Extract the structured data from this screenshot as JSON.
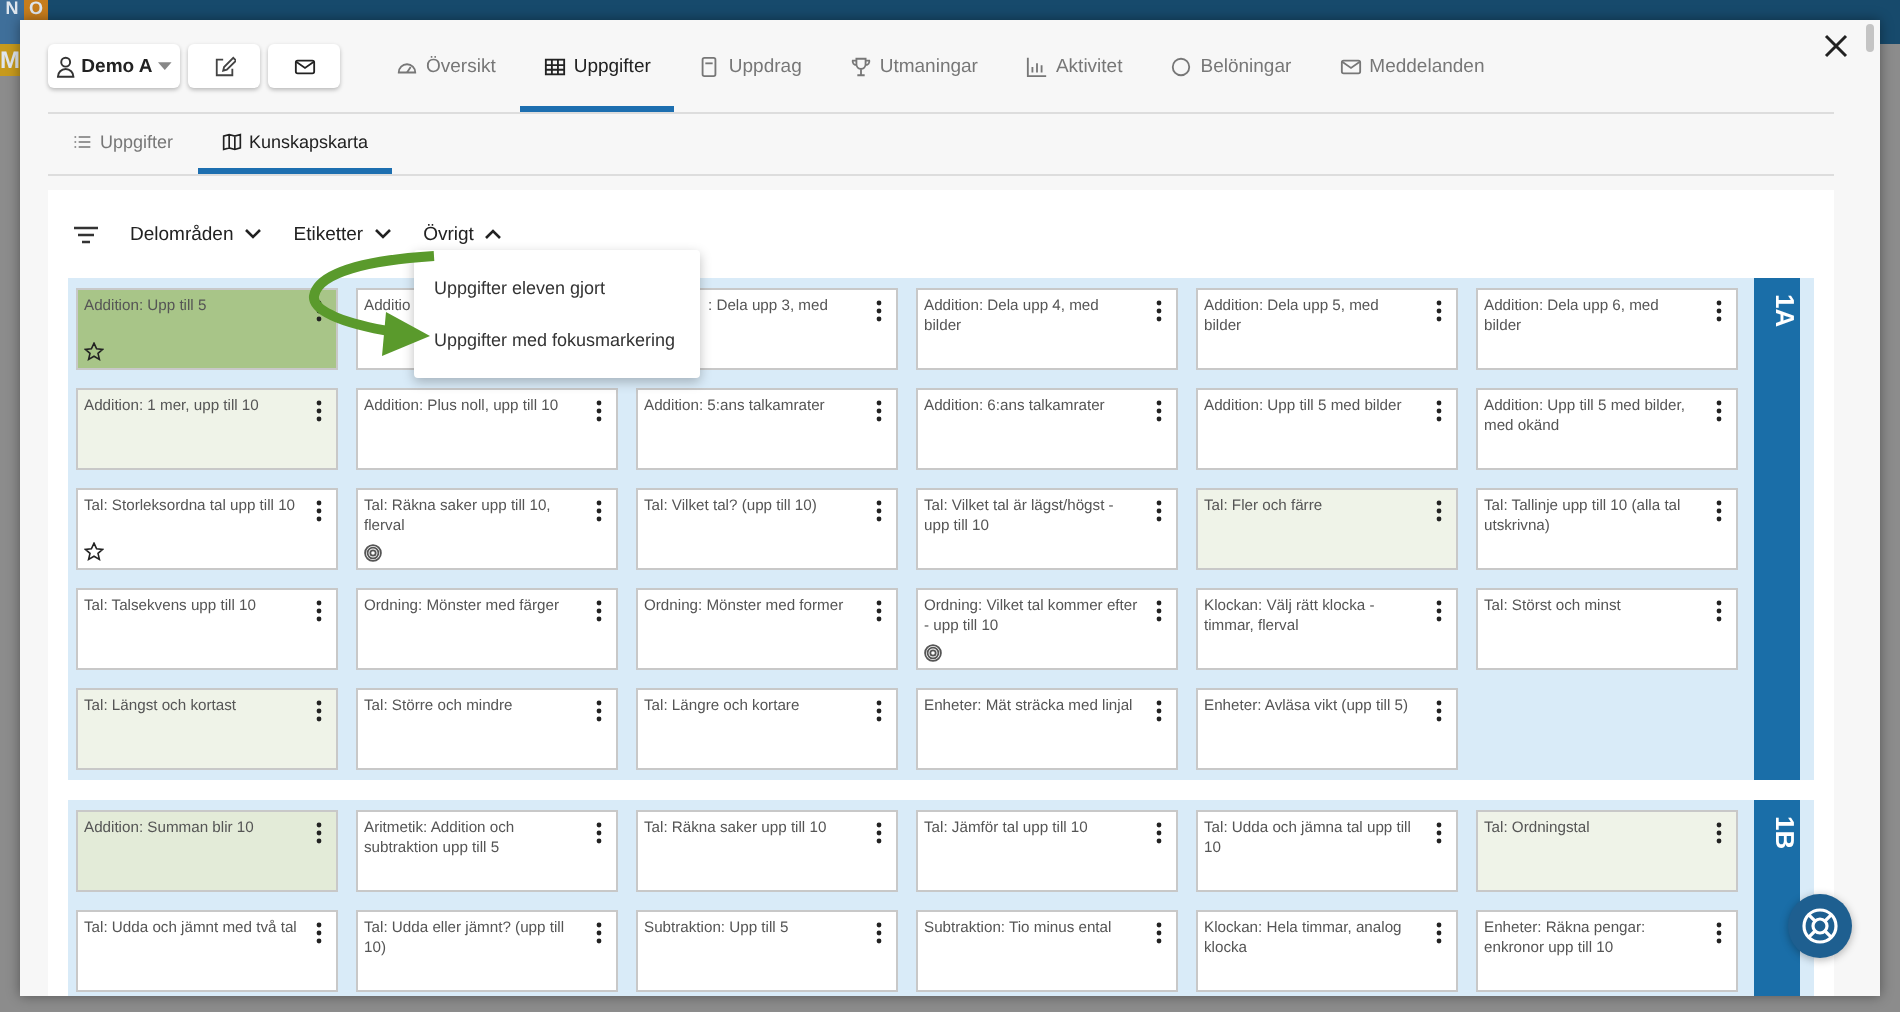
{
  "backdrop": {
    "tiles": [
      {
        "letter": "N",
        "color": "#3f6f9a"
      },
      {
        "letter": "O",
        "color": "#c77d1c"
      },
      {
        "letter": "M",
        "color": "#c79a1c"
      }
    ]
  },
  "toolbar": {
    "user": "Demo A",
    "tabs": [
      {
        "label": "Översikt",
        "selected": false
      },
      {
        "label": "Uppgifter",
        "selected": true
      },
      {
        "label": "Uppdrag",
        "selected": false
      },
      {
        "label": "Utmaningar",
        "selected": false
      },
      {
        "label": "Aktivitet",
        "selected": false
      },
      {
        "label": "Belöningar",
        "selected": false
      },
      {
        "label": "Meddelanden",
        "selected": false
      }
    ]
  },
  "subtabs": [
    {
      "label": "Uppgifter",
      "selected": false
    },
    {
      "label": "Kunskapskarta",
      "selected": true
    }
  ],
  "filters": [
    {
      "label": "Delområden",
      "expanded": false
    },
    {
      "label": "Etiketter",
      "expanded": false
    },
    {
      "label": "Övrigt",
      "expanded": true
    }
  ],
  "menu": [
    "Uppgifter eleven gjort",
    "Uppgifter med fokusmarkering"
  ],
  "sections": [
    {
      "label": "1A",
      "cards": [
        {
          "text": "Addition: Upp till 5",
          "color": "#a8c588",
          "starred": true,
          "focus": false
        },
        {
          "text": "Additio",
          "color": "#ffffff",
          "starred": false,
          "focus": false
        },
        {
          "text": ": Dela upp 3, med",
          "color": "#ffffff",
          "starred": false,
          "focus": false
        },
        {
          "text": "Addition: Dela upp 4, med bilder",
          "color": "#ffffff",
          "starred": false,
          "focus": false
        },
        {
          "text": "Addition: Dela upp 5, med bilder",
          "color": "#ffffff",
          "starred": false,
          "focus": false
        },
        {
          "text": "Addition: Dela upp 6, med bilder",
          "color": "#ffffff",
          "starred": false,
          "focus": false
        },
        {
          "text": "Addition: 1 mer, upp till 10",
          "color": "#eff3e8",
          "starred": false,
          "focus": false
        },
        {
          "text": "Addition: Plus noll, upp till 10",
          "color": "#ffffff",
          "starred": false,
          "focus": false
        },
        {
          "text": "Addition: 5:ans talkamrater",
          "color": "#ffffff",
          "starred": false,
          "focus": false
        },
        {
          "text": "Addition: 6:ans talkamrater",
          "color": "#ffffff",
          "starred": false,
          "focus": false
        },
        {
          "text": "Addition: Upp till 5 med bilder",
          "color": "#ffffff",
          "starred": false,
          "focus": false
        },
        {
          "text": "Addition: Upp till 5 med bilder, med okänd",
          "color": "#ffffff",
          "starred": false,
          "focus": false
        },
        {
          "text": "Tal: Storleksordna tal upp till 10",
          "color": "#ffffff",
          "starred": true,
          "focus": false
        },
        {
          "text": "Tal: Räkna saker upp till 10, flerval",
          "color": "#ffffff",
          "starred": false,
          "focus": true
        },
        {
          "text": "Tal: Vilket tal? (upp till 10)",
          "color": "#ffffff",
          "starred": false,
          "focus": false
        },
        {
          "text": "Tal: Vilket tal är lägst/högst - upp till 10",
          "color": "#ffffff",
          "starred": false,
          "focus": false
        },
        {
          "text": "Tal: Fler och färre",
          "color": "#eff3e8",
          "starred": false,
          "focus": false
        },
        {
          "text": "Tal: Tallinje upp till 10 (alla tal utskrivna)",
          "color": "#ffffff",
          "starred": false,
          "focus": false
        },
        {
          "text": "Tal: Talsekvens upp till 10",
          "color": "#ffffff",
          "starred": false,
          "focus": false
        },
        {
          "text": "Ordning: Mönster med färger",
          "color": "#ffffff",
          "starred": false,
          "focus": false
        },
        {
          "text": "Ordning: Mönster med former",
          "color": "#ffffff",
          "starred": false,
          "focus": false
        },
        {
          "text": "Ordning: Vilket tal kommer efter - upp till 10",
          "color": "#ffffff",
          "starred": false,
          "focus": true
        },
        {
          "text": "Klockan: Välj rätt klocka - timmar, flerval",
          "color": "#ffffff",
          "starred": false,
          "focus": false
        },
        {
          "text": "Tal: Störst och minst",
          "color": "#ffffff",
          "starred": false,
          "focus": false
        },
        {
          "text": "Tal: Längst och kortast",
          "color": "#eff3e8",
          "starred": false,
          "focus": false
        },
        {
          "text": "Tal: Större och mindre",
          "color": "#ffffff",
          "starred": false,
          "focus": false
        },
        {
          "text": "Tal: Längre och kortare",
          "color": "#ffffff",
          "starred": false,
          "focus": false
        },
        {
          "text": "Enheter: Mät sträcka med linjal",
          "color": "#ffffff",
          "starred": false,
          "focus": false
        },
        {
          "text": "Enheter: Avläsa vikt (upp till 5)",
          "color": "#ffffff",
          "starred": false,
          "focus": false
        }
      ]
    },
    {
      "label": "1B",
      "cards": [
        {
          "text": "Addition: Summan blir 10",
          "color": "#e3ebd8",
          "starred": false,
          "focus": false
        },
        {
          "text": "Aritmetik: Addition och subtraktion upp till 5",
          "color": "#ffffff",
          "starred": false,
          "focus": false
        },
        {
          "text": "Tal: Räkna saker upp till 10",
          "color": "#ffffff",
          "starred": false,
          "focus": false
        },
        {
          "text": "Tal: Jämför tal upp till 10",
          "color": "#ffffff",
          "starred": false,
          "focus": false
        },
        {
          "text": "Tal: Udda och jämna tal upp till 10",
          "color": "#ffffff",
          "starred": false,
          "focus": false
        },
        {
          "text": "Tal: Ordningstal",
          "color": "#eff3e8",
          "starred": false,
          "focus": false
        },
        {
          "text": "Tal: Udda och jämnt med två tal",
          "color": "#ffffff",
          "starred": false,
          "focus": false
        },
        {
          "text": "Tal: Udda eller jämnt? (upp till 10)",
          "color": "#ffffff",
          "starred": false,
          "focus": false
        },
        {
          "text": "Subtraktion: Upp till 5",
          "color": "#ffffff",
          "starred": false,
          "focus": false
        },
        {
          "text": "Subtraktion: Tio minus ental",
          "color": "#ffffff",
          "starred": false,
          "focus": false
        },
        {
          "text": "Klockan: Hela timmar, analog klocka",
          "color": "#ffffff",
          "starred": false,
          "focus": false
        },
        {
          "text": "Enheter: Räkna pengar: enkronor upp till 10",
          "color": "#ffffff",
          "starred": false,
          "focus": false
        }
      ]
    }
  ]
}
